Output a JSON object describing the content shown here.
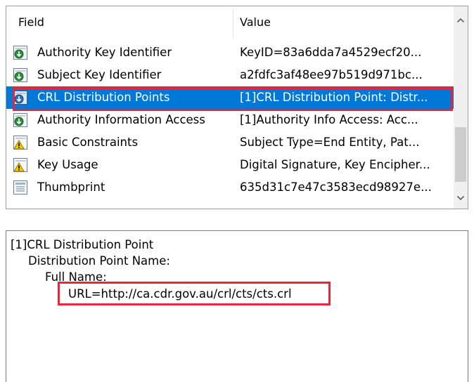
{
  "list": {
    "headers": {
      "field": "Field",
      "value": "Value"
    },
    "rows": [
      {
        "field": "Authority Key Identifier",
        "value": "KeyID=83a6dda7a4529ecf20...",
        "icon": "certificate-extension-icon",
        "selected": false
      },
      {
        "field": "Subject Key Identifier",
        "value": "a2fdfc3af48ee97b519d971bc...",
        "icon": "certificate-extension-icon",
        "selected": false
      },
      {
        "field": "CRL Distribution Points",
        "value": "[1]CRL Distribution Point: Distr...",
        "icon": "certificate-extension-icon",
        "selected": true
      },
      {
        "field": "Authority Information Access",
        "value": "[1]Authority Info Access: Acc...",
        "icon": "certificate-extension-icon",
        "selected": false
      },
      {
        "field": "Basic Constraints",
        "value": "Subject Type=End Entity, Pat...",
        "icon": "critical-extension-warning-icon",
        "selected": false
      },
      {
        "field": "Key Usage",
        "value": "Digital Signature, Key Encipher...",
        "icon": "critical-extension-warning-icon",
        "selected": false
      },
      {
        "field": "Thumbprint",
        "value": "635d31c7e47c3583ecd98927e...",
        "icon": "document-property-icon",
        "selected": false
      }
    ]
  },
  "detail": {
    "lines": [
      "[1]CRL Distribution Point",
      "Distribution Point Name:",
      "Full Name:",
      "URL=http://ca.cdr.gov.au/crl/cts/cts.crl"
    ]
  },
  "colors": {
    "selection": "#0078d7",
    "highlight_outline": "#e2283d",
    "scrollbar_track": "#f0f0f0",
    "scrollbar_thumb": "#cdcdcd"
  }
}
